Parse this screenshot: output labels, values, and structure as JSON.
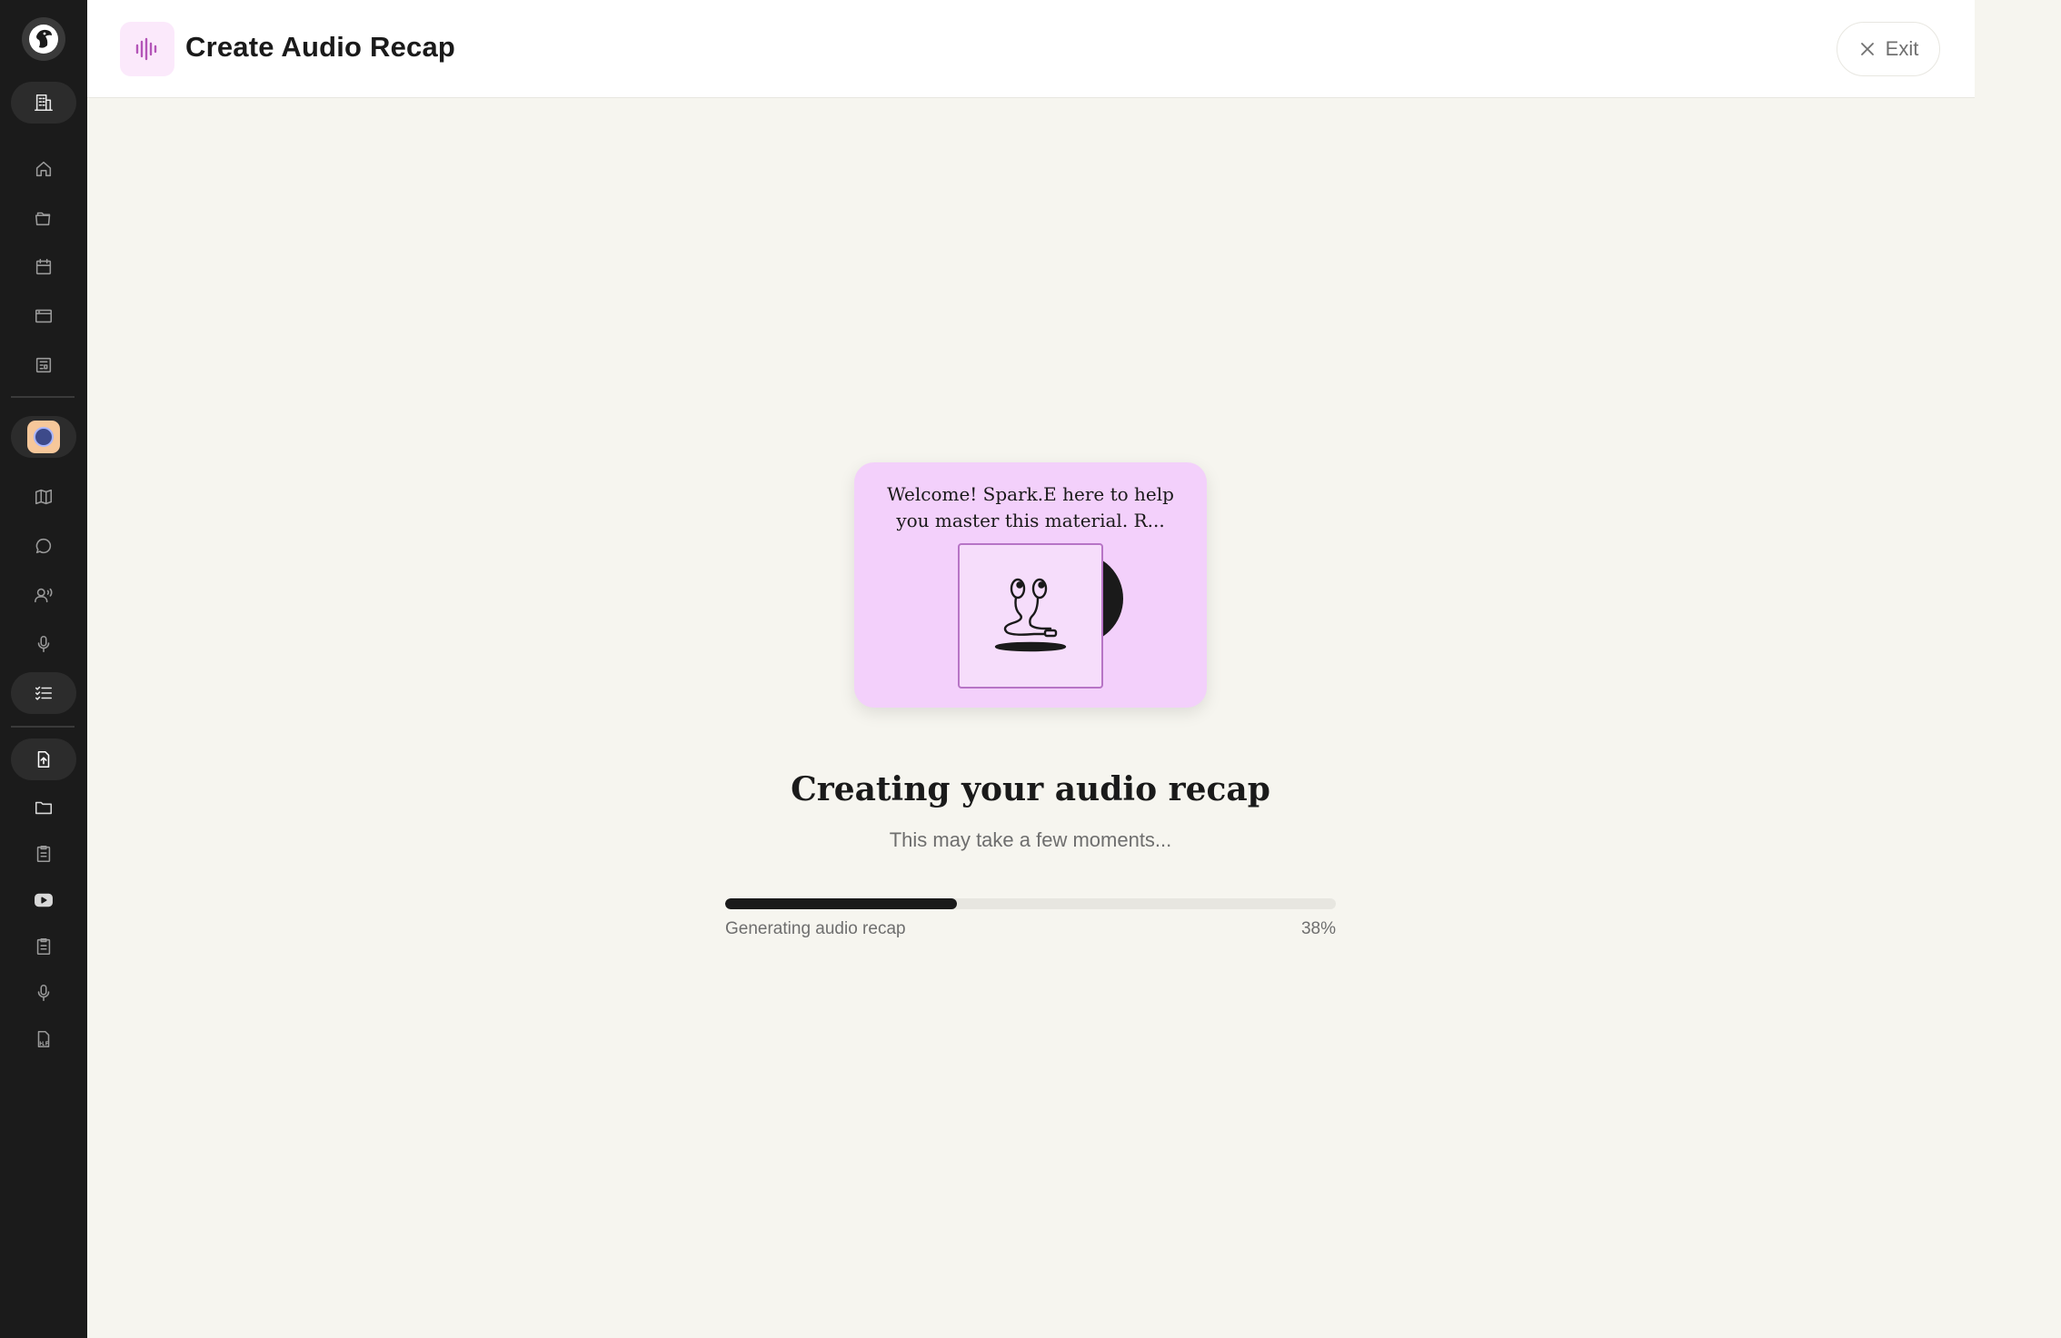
{
  "header": {
    "title": "Create Audio Recap",
    "exit_label": "Exit"
  },
  "sidebar": {
    "icons": [
      "building-icon",
      "home-icon",
      "folders-icon",
      "calendar-icon",
      "browser-icon",
      "book-icon",
      "avatar",
      "map-icon",
      "chat-icon",
      "voice-user-icon",
      "microphone-icon",
      "checklist-icon",
      "file-upload-icon",
      "folder-icon",
      "document-icon",
      "youtube-icon",
      "clipboard-icon",
      "microphone-icon",
      "pdf-icon"
    ]
  },
  "card": {
    "text": "Welcome! Spark.E here to help you master this material. R..."
  },
  "status": {
    "title": "Creating your audio recap",
    "subtitle": "This may take a few moments...",
    "progress_label": "Generating audio recap",
    "progress_percent": "38%",
    "progress_value": 0.38
  },
  "colors": {
    "accent": "#b455b8",
    "card_bg": "#f3d0fb",
    "sidebar_bg": "#1b1b1b",
    "page_bg": "#f6f5ef"
  }
}
